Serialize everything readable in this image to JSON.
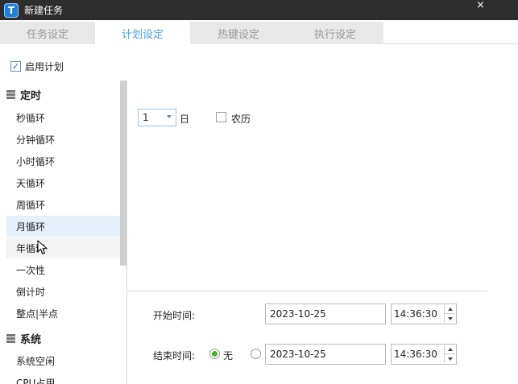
{
  "window": {
    "title": "新建任务",
    "icon_letter": "T",
    "close_glyph": "×"
  },
  "tabs": [
    {
      "label": "任务设定",
      "active": false
    },
    {
      "label": "计划设定",
      "active": true
    },
    {
      "label": "热键设定",
      "active": false
    },
    {
      "label": "执行设定",
      "active": false
    }
  ],
  "enable_plan": {
    "label": "启用计划",
    "checked": true
  },
  "sidebar": {
    "groups": [
      {
        "label": "定时",
        "icon": "list-icon"
      },
      {
        "label": "系统",
        "icon": "list-icon"
      }
    ],
    "items": [
      {
        "label": "秒循环"
      },
      {
        "label": "分钟循环"
      },
      {
        "label": "小时循环"
      },
      {
        "label": "天循环"
      },
      {
        "label": "周循环"
      },
      {
        "label": "月循环",
        "selected": true
      },
      {
        "label": "年循环"
      },
      {
        "label": "一次性"
      },
      {
        "label": "倒计时"
      },
      {
        "label": "整点|半点"
      },
      {
        "label": "系统空闲"
      },
      {
        "label": "CPU占用"
      }
    ]
  },
  "monthly": {
    "day_value": "1",
    "day_unit": "日",
    "lunar_label": "农历",
    "lunar_checked": false
  },
  "start": {
    "label": "开始时间:",
    "date": "2023-10-25",
    "time": "14:36:30"
  },
  "end": {
    "label": "结束时间:",
    "none_label": "无",
    "none_selected": true,
    "date": "2023-10-25",
    "time": "14:36:30"
  }
}
